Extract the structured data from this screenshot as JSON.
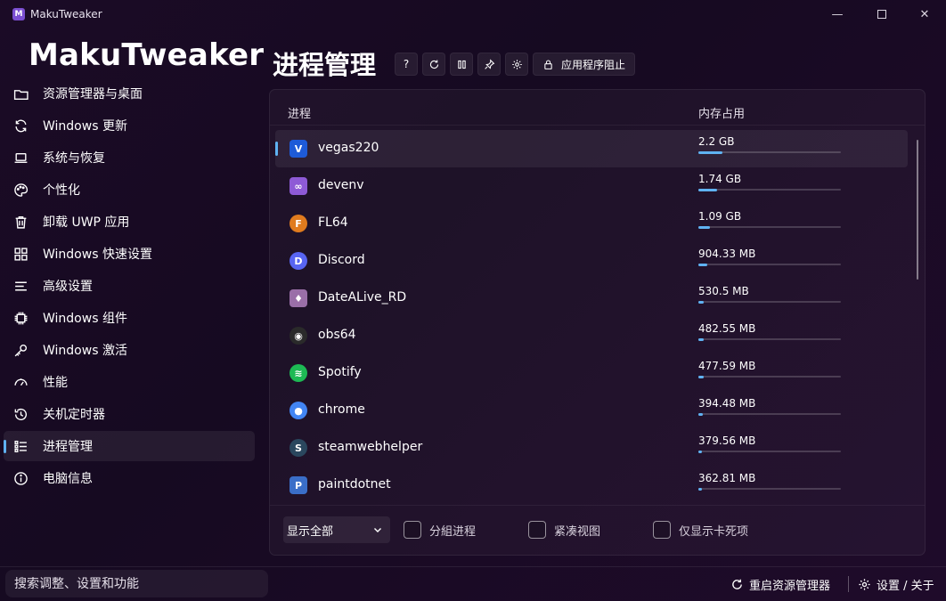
{
  "window": {
    "title": "MakuTweaker",
    "logo_letter": "M",
    "minimize_glyph": "—",
    "close_glyph": "✕"
  },
  "brand": "MakuTweaker",
  "sidebar": {
    "items": [
      {
        "label": "资源管理器与桌面",
        "icon": "folder-icon"
      },
      {
        "label": "Windows 更新",
        "icon": "sync-icon"
      },
      {
        "label": "系统与恢复",
        "icon": "laptop-icon"
      },
      {
        "label": "个性化",
        "icon": "palette-icon"
      },
      {
        "label": "卸载 UWP 应用",
        "icon": "trash-icon"
      },
      {
        "label": "Windows 快速设置",
        "icon": "grid-icon"
      },
      {
        "label": "高级设置",
        "icon": "lines-icon"
      },
      {
        "label": "Windows 组件",
        "icon": "chip-icon"
      },
      {
        "label": "Windows 激活",
        "icon": "key-icon"
      },
      {
        "label": "性能",
        "icon": "gauge-icon"
      },
      {
        "label": "关机定时器",
        "icon": "history-icon"
      },
      {
        "label": "进程管理",
        "icon": "list-icon"
      },
      {
        "label": "电脑信息",
        "icon": "info-icon"
      }
    ],
    "active_index": 11
  },
  "page": {
    "title": "进程管理",
    "help_label": "?",
    "block_label": "应用程序阻止"
  },
  "table": {
    "col_process": "进程",
    "col_memory": "内存占用",
    "rows": [
      {
        "name": "vegas220",
        "memory": "2.2 GB",
        "usage": 0.17,
        "icon": "vegas-icon",
        "color": "#1e5bd8",
        "glyph": "V"
      },
      {
        "name": "devenv",
        "memory": "1.74 GB",
        "usage": 0.13,
        "icon": "visual-studio-icon",
        "color": "#8e5ad6",
        "glyph": "∞"
      },
      {
        "name": "FL64",
        "memory": "1.09 GB",
        "usage": 0.08,
        "icon": "fl-studio-icon",
        "color": "#e07b1e",
        "glyph": "F"
      },
      {
        "name": "Discord",
        "memory": "904.33 MB",
        "usage": 0.065,
        "icon": "discord-icon",
        "color": "#5865f2",
        "glyph": "D"
      },
      {
        "name": "DateALive_RD",
        "memory": "530.5 MB",
        "usage": 0.04,
        "icon": "datealive-icon",
        "color": "#9a6fa8",
        "glyph": "♦"
      },
      {
        "name": "obs64",
        "memory": "482.55 MB",
        "usage": 0.035,
        "icon": "obs-icon",
        "color": "#2a2a2a",
        "glyph": "◉"
      },
      {
        "name": "Spotify",
        "memory": "477.59 MB",
        "usage": 0.035,
        "icon": "spotify-icon",
        "color": "#1db954",
        "glyph": "≋"
      },
      {
        "name": "chrome",
        "memory": "394.48 MB",
        "usage": 0.03,
        "icon": "chrome-icon",
        "color": "#4285f4",
        "glyph": "●"
      },
      {
        "name": "steamwebhelper",
        "memory": "379.56 MB",
        "usage": 0.028,
        "icon": "steam-icon",
        "color": "#2a475e",
        "glyph": "S"
      },
      {
        "name": "paintdotnet",
        "memory": "362.81 MB",
        "usage": 0.026,
        "icon": "paintdotnet-icon",
        "color": "#3a6ec8",
        "glyph": "P"
      }
    ],
    "selected_index": 0
  },
  "filters": {
    "show_selected": "显示全部",
    "group_label": "分組进程",
    "compact_label": "紧凑视图",
    "hung_label": "仅显示卡死项"
  },
  "footer": {
    "search_placeholder": "搜索调整、设置和功能",
    "restart_explorer": "重启资源管理器",
    "settings_about": "设置 / 关于"
  },
  "colors": {
    "accent": "#5fb2f2",
    "background": "#1b0b26"
  }
}
